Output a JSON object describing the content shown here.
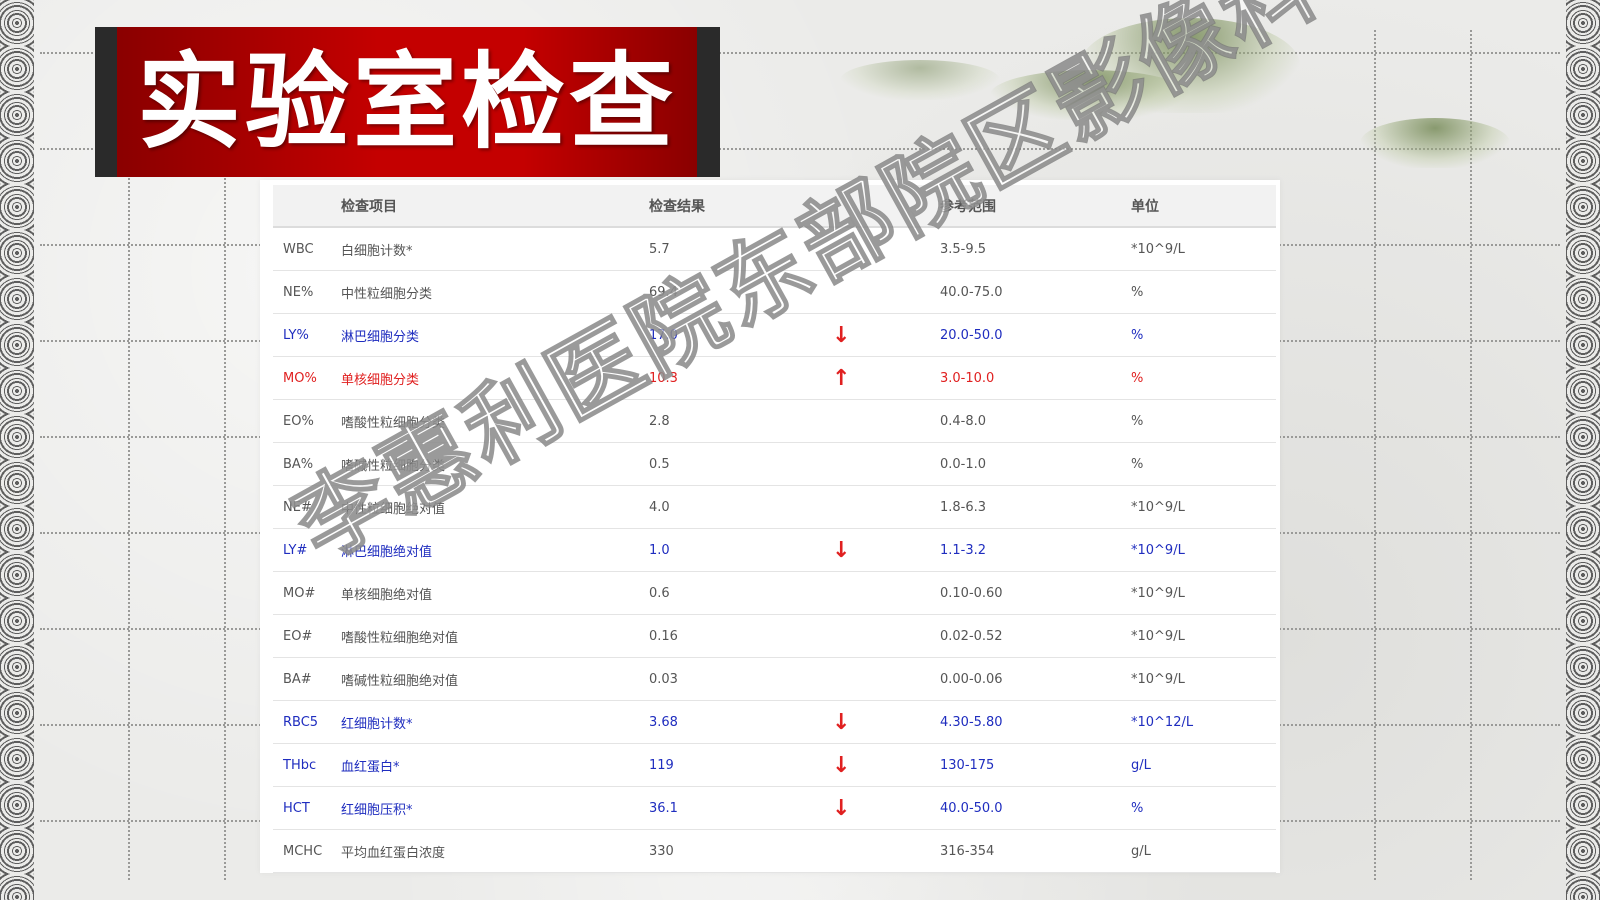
{
  "title": "实验室检查",
  "watermark": "李惠利医院东部院区影像科",
  "table": {
    "headers": [
      "",
      "检查项目",
      "检查结果",
      "",
      "参考范围",
      "单位"
    ],
    "rows": [
      {
        "code": "WBC",
        "name": "白细胞计数*",
        "result": "5.7",
        "flag": "",
        "range": "3.5-9.5",
        "unit": "*10^9/L",
        "status": "normal"
      },
      {
        "code": "NE%",
        "name": "中性粒细胞分类",
        "result": "69.4",
        "flag": "",
        "range": "40.0-75.0",
        "unit": "%",
        "status": "normal"
      },
      {
        "code": "LY%",
        "name": "淋巴细胞分类",
        "result": "17.0",
        "flag": "↓",
        "range": "20.0-50.0",
        "unit": "%",
        "status": "low"
      },
      {
        "code": "MO%",
        "name": "单核细胞分类",
        "result": "10.3",
        "flag": "↑",
        "range": "3.0-10.0",
        "unit": "%",
        "status": "high"
      },
      {
        "code": "EO%",
        "name": "嗜酸性粒细胞分类",
        "result": "2.8",
        "flag": "",
        "range": "0.4-8.0",
        "unit": "%",
        "status": "normal"
      },
      {
        "code": "BA%",
        "name": "嗜碱性粒细胞分类",
        "result": "0.5",
        "flag": "",
        "range": "0.0-1.0",
        "unit": "%",
        "status": "normal"
      },
      {
        "code": "NE#",
        "name": "中性粒细胞绝对值",
        "result": "4.0",
        "flag": "",
        "range": "1.8-6.3",
        "unit": "*10^9/L",
        "status": "normal"
      },
      {
        "code": "LY#",
        "name": "淋巴细胞绝对值",
        "result": "1.0",
        "flag": "↓",
        "range": "1.1-3.2",
        "unit": "*10^9/L",
        "status": "low"
      },
      {
        "code": "MO#",
        "name": "单核细胞绝对值",
        "result": "0.6",
        "flag": "",
        "range": "0.10-0.60",
        "unit": "*10^9/L",
        "status": "normal"
      },
      {
        "code": "EO#",
        "name": "嗜酸性粒细胞绝对值",
        "result": "0.16",
        "flag": "",
        "range": "0.02-0.52",
        "unit": "*10^9/L",
        "status": "normal"
      },
      {
        "code": "BA#",
        "name": "嗜碱性粒细胞绝对值",
        "result": "0.03",
        "flag": "",
        "range": "0.00-0.06",
        "unit": "*10^9/L",
        "status": "normal"
      },
      {
        "code": "RBC5",
        "name": "红细胞计数*",
        "result": "3.68",
        "flag": "↓",
        "range": "4.30-5.80",
        "unit": "*10^12/L",
        "status": "low"
      },
      {
        "code": "THbc",
        "name": "血红蛋白*",
        "result": "119",
        "flag": "↓",
        "range": "130-175",
        "unit": "g/L",
        "status": "low"
      },
      {
        "code": "HCT",
        "name": "红细胞压积*",
        "result": "36.1",
        "flag": "↓",
        "range": "40.0-50.0",
        "unit": "%",
        "status": "low"
      },
      {
        "code": "MCHC",
        "name": "平均血红蛋白浓度",
        "result": "330",
        "flag": "",
        "range": "316-354",
        "unit": "g/L",
        "status": "normal"
      }
    ]
  },
  "colors": {
    "title_bg": "#c40000",
    "low": "#1f2dbf",
    "high": "#e02020",
    "normal": "#555555"
  }
}
